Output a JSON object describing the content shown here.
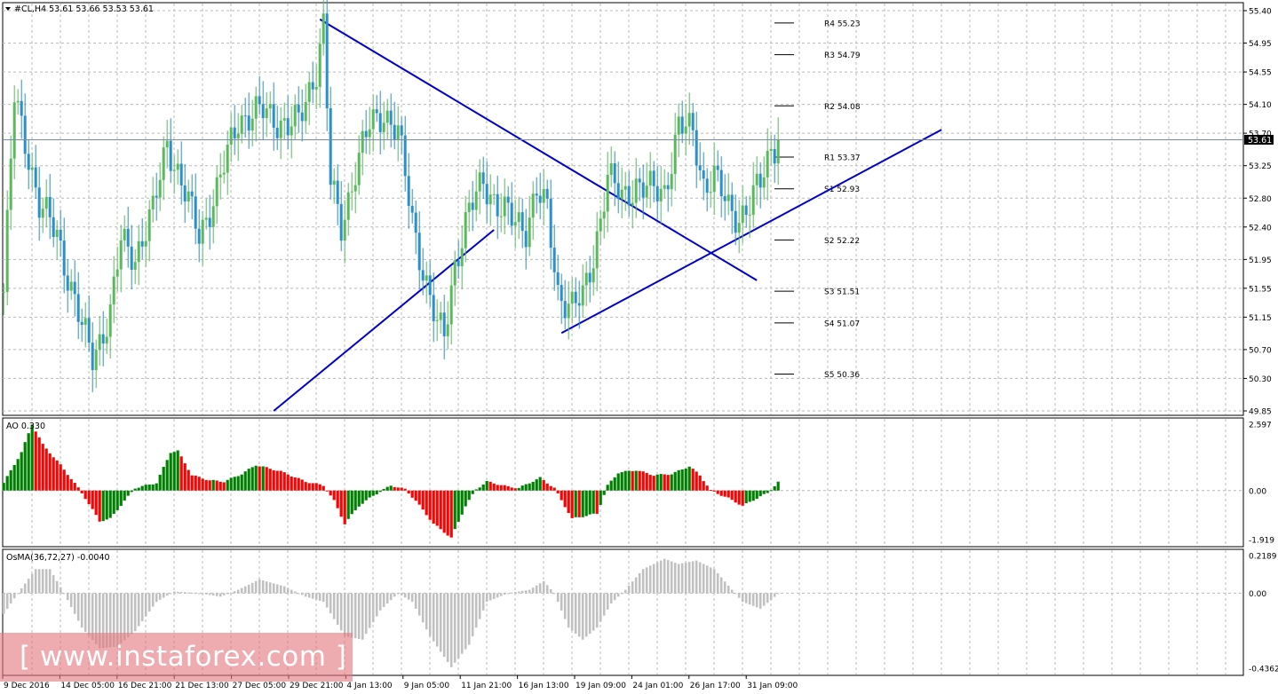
{
  "chart_data": [
    {
      "type": "candlestick",
      "title": "#CL,H4  53.61 53.66 53.53 53.61",
      "ylim": [
        49.85,
        55.4
      ],
      "y_ticks": [
        "55.40",
        "54.95",
        "54.55",
        "54.10",
        "53.70",
        "53.25",
        "52.80",
        "52.40",
        "51.95",
        "51.55",
        "51.15",
        "50.70",
        "50.30",
        "49.85"
      ],
      "current_price": "53.61",
      "pivot_levels": [
        {
          "label": "R4 55.23",
          "value": 55.23
        },
        {
          "label": "R3 54.79",
          "value": 54.79
        },
        {
          "label": "R2 54.08",
          "value": 54.08
        },
        {
          "label": "R1 53.37",
          "value": 53.37
        },
        {
          "label": "S1 52.93",
          "value": 52.93
        },
        {
          "label": "S2 52.22",
          "value": 52.22
        },
        {
          "label": "S3 51.51",
          "value": 51.51
        },
        {
          "label": "S4 51.07",
          "value": 51.07
        },
        {
          "label": "S5 50.36",
          "value": 50.36
        }
      ],
      "x_labels": [
        "9 Dec 2016",
        "14 Dec 05:00",
        "16 Dec 21:00",
        "21 Dec 13:00",
        "27 Dec 05:00",
        "29 Dec 21:00",
        "4 Jan 13:00",
        "9 Jan 05:00",
        "11 Jan 21:00",
        "16 Jan 13:00",
        "19 Jan 09:00",
        "24 Jan 01:00",
        "26 Jan 17:00",
        "31 Jan 09:00"
      ],
      "price_path": [
        {
          "bar": 0,
          "price": 51.5
        },
        {
          "bar": 3,
          "price": 54.2
        },
        {
          "bar": 7,
          "price": 53.4
        },
        {
          "bar": 10,
          "price": 52.7
        },
        {
          "bar": 15,
          "price": 52.3
        },
        {
          "bar": 22,
          "price": 51.0
        },
        {
          "bar": 25,
          "price": 50.6
        },
        {
          "bar": 30,
          "price": 51.2
        },
        {
          "bar": 33,
          "price": 52.2
        },
        {
          "bar": 37,
          "price": 52.0
        },
        {
          "bar": 42,
          "price": 52.6
        },
        {
          "bar": 46,
          "price": 53.6
        },
        {
          "bar": 50,
          "price": 53.0
        },
        {
          "bar": 55,
          "price": 52.3
        },
        {
          "bar": 60,
          "price": 52.9
        },
        {
          "bar": 66,
          "price": 53.9
        },
        {
          "bar": 73,
          "price": 54.0
        },
        {
          "bar": 80,
          "price": 53.8
        },
        {
          "bar": 83,
          "price": 53.85
        },
        {
          "bar": 88,
          "price": 54.6
        },
        {
          "bar": 90,
          "price": 55.2
        },
        {
          "bar": 92,
          "price": 53.0
        },
        {
          "bar": 95,
          "price": 52.4
        },
        {
          "bar": 99,
          "price": 53.2
        },
        {
          "bar": 103,
          "price": 53.8
        },
        {
          "bar": 107,
          "price": 54.0
        },
        {
          "bar": 111,
          "price": 53.7
        },
        {
          "bar": 115,
          "price": 52.5
        },
        {
          "bar": 119,
          "price": 51.6
        },
        {
          "bar": 122,
          "price": 51.0
        },
        {
          "bar": 124,
          "price": 50.9
        },
        {
          "bar": 127,
          "price": 51.9
        },
        {
          "bar": 131,
          "price": 52.6
        },
        {
          "bar": 135,
          "price": 53.05
        },
        {
          "bar": 139,
          "price": 52.7
        },
        {
          "bar": 143,
          "price": 52.5
        },
        {
          "bar": 147,
          "price": 52.4
        },
        {
          "bar": 150,
          "price": 52.9
        },
        {
          "bar": 153,
          "price": 52.6
        },
        {
          "bar": 156,
          "price": 51.5
        },
        {
          "bar": 160,
          "price": 51.3
        },
        {
          "bar": 163,
          "price": 51.4
        },
        {
          "bar": 166,
          "price": 52.0
        },
        {
          "bar": 170,
          "price": 53.1
        },
        {
          "bar": 174,
          "price": 52.8
        },
        {
          "bar": 178,
          "price": 53.0
        },
        {
          "bar": 182,
          "price": 52.9
        },
        {
          "bar": 186,
          "price": 52.9
        },
        {
          "bar": 190,
          "price": 53.8
        },
        {
          "bar": 194,
          "price": 53.7
        },
        {
          "bar": 197,
          "price": 53.0
        },
        {
          "bar": 200,
          "price": 53.1
        },
        {
          "bar": 204,
          "price": 52.65
        },
        {
          "bar": 207,
          "price": 52.55
        },
        {
          "bar": 210,
          "price": 52.7
        },
        {
          "bar": 213,
          "price": 53.0
        },
        {
          "bar": 216,
          "price": 53.5
        },
        {
          "bar": 218,
          "price": 53.61
        }
      ],
      "trend_lines": [
        {
          "from": {
            "bar": 89,
            "price": 55.28
          },
          "to": {
            "bar": 212,
            "price": 51.66
          }
        },
        {
          "from": {
            "bar": 76,
            "price": 49.85
          },
          "to": {
            "bar": 138,
            "price": 52.36
          }
        },
        {
          "from": {
            "bar": 157,
            "price": 50.93
          },
          "to": {
            "bar": 264,
            "price": 53.75
          }
        }
      ]
    },
    {
      "type": "bar",
      "title": "AO 0.330",
      "name": "AO",
      "value": 0.33,
      "ylim": [
        -1.919,
        2.597
      ],
      "y_ticks": [
        "2.597",
        "0.00",
        "-1.919"
      ],
      "colors": {
        "up": "#008000",
        "down": "#ff0000"
      },
      "anchors": [
        {
          "bar": 0,
          "value": 0.3
        },
        {
          "bar": 5,
          "value": 1.5
        },
        {
          "bar": 8,
          "value": 2.6
        },
        {
          "bar": 11,
          "value": 1.8
        },
        {
          "bar": 16,
          "value": 1.0
        },
        {
          "bar": 21,
          "value": 0.1
        },
        {
          "bar": 23,
          "value": -0.3
        },
        {
          "bar": 27,
          "value": -1.2
        },
        {
          "bar": 30,
          "value": -1.1
        },
        {
          "bar": 34,
          "value": -0.4
        },
        {
          "bar": 37,
          "value": 0.1
        },
        {
          "bar": 43,
          "value": 0.3
        },
        {
          "bar": 47,
          "value": 1.5
        },
        {
          "bar": 49,
          "value": 1.55
        },
        {
          "bar": 53,
          "value": 0.6
        },
        {
          "bar": 58,
          "value": 0.4
        },
        {
          "bar": 62,
          "value": 0.35
        },
        {
          "bar": 67,
          "value": 0.65
        },
        {
          "bar": 71,
          "value": 1.0
        },
        {
          "bar": 78,
          "value": 0.75
        },
        {
          "bar": 85,
          "value": 0.35
        },
        {
          "bar": 90,
          "value": 0.2
        },
        {
          "bar": 93,
          "value": -0.4
        },
        {
          "bar": 96,
          "value": -1.3
        },
        {
          "bar": 100,
          "value": -0.6
        },
        {
          "bar": 104,
          "value": -0.2
        },
        {
          "bar": 109,
          "value": 0.2
        },
        {
          "bar": 113,
          "value": 0.05
        },
        {
          "bar": 116,
          "value": -0.4
        },
        {
          "bar": 121,
          "value": -1.3
        },
        {
          "bar": 126,
          "value": -1.85
        },
        {
          "bar": 130,
          "value": -0.6
        },
        {
          "bar": 133,
          "value": 0.05
        },
        {
          "bar": 136,
          "value": 0.35
        },
        {
          "bar": 142,
          "value": 0.15
        },
        {
          "bar": 145,
          "value": 0.1
        },
        {
          "bar": 148,
          "value": 0.3
        },
        {
          "bar": 151,
          "value": 0.5
        },
        {
          "bar": 155,
          "value": 0.1
        },
        {
          "bar": 160,
          "value": -1.1
        },
        {
          "bar": 167,
          "value": -0.9
        },
        {
          "bar": 170,
          "value": 0.2
        },
        {
          "bar": 173,
          "value": 0.7
        },
        {
          "bar": 178,
          "value": 0.8
        },
        {
          "bar": 183,
          "value": 0.6
        },
        {
          "bar": 188,
          "value": 0.65
        },
        {
          "bar": 193,
          "value": 0.95
        },
        {
          "bar": 196,
          "value": 0.6
        },
        {
          "bar": 199,
          "value": 0.0
        },
        {
          "bar": 204,
          "value": -0.3
        },
        {
          "bar": 208,
          "value": -0.6
        },
        {
          "bar": 212,
          "value": -0.3
        },
        {
          "bar": 215,
          "value": -0.1
        },
        {
          "bar": 218,
          "value": 0.33
        }
      ]
    },
    {
      "type": "bar",
      "title": "OsMA(36,72,27) -0.0040",
      "name": "OsMA(36,72,27)",
      "value": -0.004,
      "ylim": [
        -0.4362,
        0.2189
      ],
      "y_ticks": [
        "0.2189",
        "0.00",
        "-0.4362"
      ],
      "color": "#c0c0c0",
      "anchors": [
        {
          "bar": 0,
          "value": -0.12
        },
        {
          "bar": 4,
          "value": 0.0
        },
        {
          "bar": 9,
          "value": 0.14
        },
        {
          "bar": 13,
          "value": 0.14
        },
        {
          "bar": 17,
          "value": 0.0
        },
        {
          "bar": 22,
          "value": -0.2
        },
        {
          "bar": 27,
          "value": -0.32
        },
        {
          "bar": 32,
          "value": -0.31
        },
        {
          "bar": 37,
          "value": -0.22
        },
        {
          "bar": 43,
          "value": -0.05
        },
        {
          "bar": 48,
          "value": 0.01
        },
        {
          "bar": 55,
          "value": 0.0
        },
        {
          "bar": 61,
          "value": -0.02
        },
        {
          "bar": 66,
          "value": 0.02
        },
        {
          "bar": 72,
          "value": 0.08
        },
        {
          "bar": 79,
          "value": 0.04
        },
        {
          "bar": 85,
          "value": -0.02
        },
        {
          "bar": 90,
          "value": -0.05
        },
        {
          "bar": 96,
          "value": -0.25
        },
        {
          "bar": 101,
          "value": -0.27
        },
        {
          "bar": 106,
          "value": -0.1
        },
        {
          "bar": 111,
          "value": 0.0
        },
        {
          "bar": 115,
          "value": -0.05
        },
        {
          "bar": 120,
          "value": -0.25
        },
        {
          "bar": 126,
          "value": -0.43
        },
        {
          "bar": 131,
          "value": -0.3
        },
        {
          "bar": 136,
          "value": -0.05
        },
        {
          "bar": 142,
          "value": 0.0
        },
        {
          "bar": 148,
          "value": 0.02
        },
        {
          "bar": 152,
          "value": 0.07
        },
        {
          "bar": 155,
          "value": 0.0
        },
        {
          "bar": 159,
          "value": -0.2
        },
        {
          "bar": 163,
          "value": -0.27
        },
        {
          "bar": 167,
          "value": -0.2
        },
        {
          "bar": 171,
          "value": -0.06
        },
        {
          "bar": 175,
          "value": 0.02
        },
        {
          "bar": 180,
          "value": 0.14
        },
        {
          "bar": 186,
          "value": 0.2
        },
        {
          "bar": 190,
          "value": 0.17
        },
        {
          "bar": 195,
          "value": 0.19
        },
        {
          "bar": 200,
          "value": 0.14
        },
        {
          "bar": 205,
          "value": 0.02
        },
        {
          "bar": 208,
          "value": -0.05
        },
        {
          "bar": 213,
          "value": -0.09
        },
        {
          "bar": 218,
          "value": -0.004
        }
      ]
    }
  ],
  "colors": {
    "bull_candle": "#5cb85c",
    "bear_candle": "#2d8fc7",
    "trend_line": "#0000cd",
    "price_line": "#788ca8",
    "grid": "#b8b8b8",
    "watermark_bg": "#e4787f"
  },
  "watermark": {
    "text": "[  www.instaforex.com ]"
  }
}
